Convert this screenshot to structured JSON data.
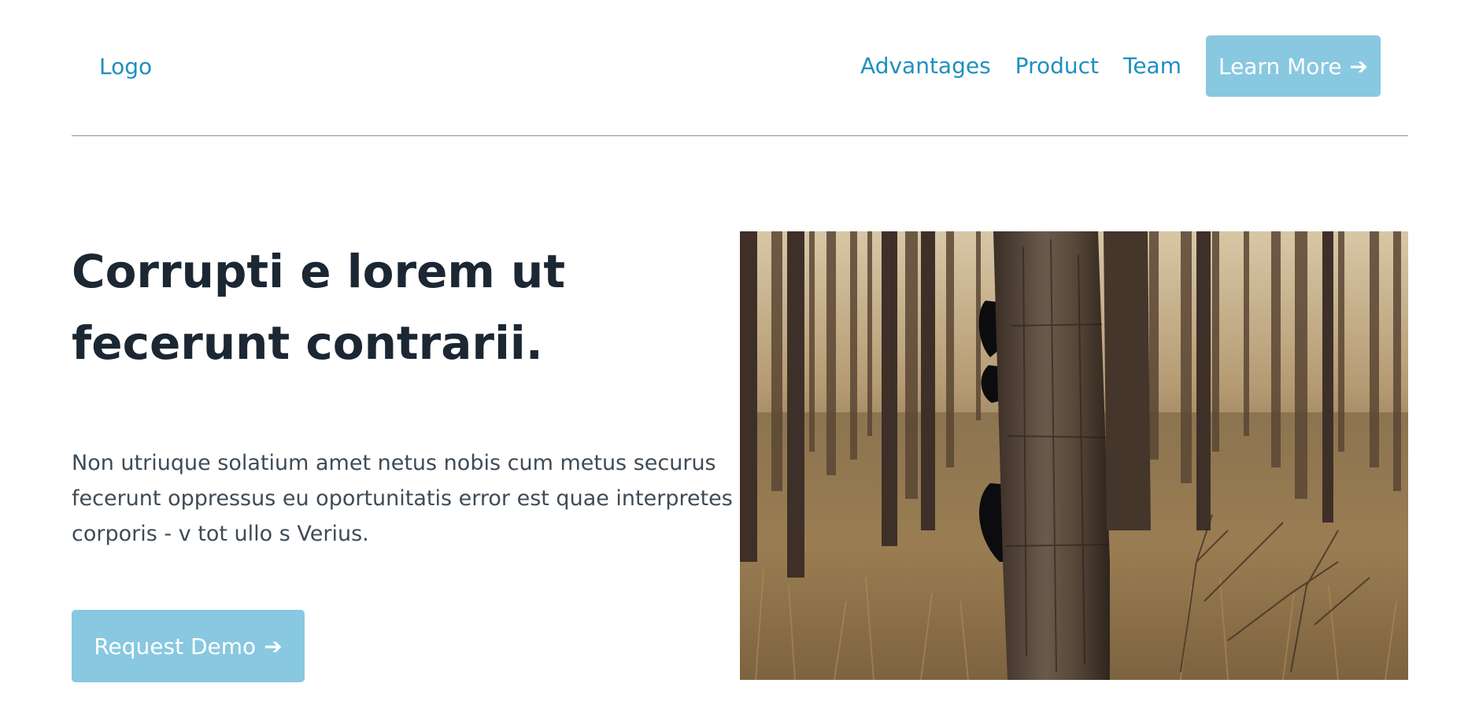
{
  "header": {
    "logo": "Logo",
    "nav": {
      "advantages": "Advantages",
      "product": "Product",
      "team": "Team"
    },
    "cta_label": "Learn More",
    "cta_arrow": "➔"
  },
  "hero": {
    "title": "Corrupti e lorem ut fecerunt contrarii.",
    "text": "Non utriuque solatium amet netus nobis cum metus securus fecerunt oppressus eu oportunitatis error est quae interpretes corporis - v tot ullo s Verius.",
    "cta_label": "Request Demo",
    "cta_arrow": "➔"
  },
  "colors": {
    "link": "#1f8fc0",
    "button_bg": "#88c8e0",
    "button_text": "#ffffff",
    "heading": "#1b2733",
    "body_text": "#3f4b56",
    "divider": "#8a8f94"
  },
  "icons": {
    "cta_arrow": "right-arrow-icon"
  }
}
